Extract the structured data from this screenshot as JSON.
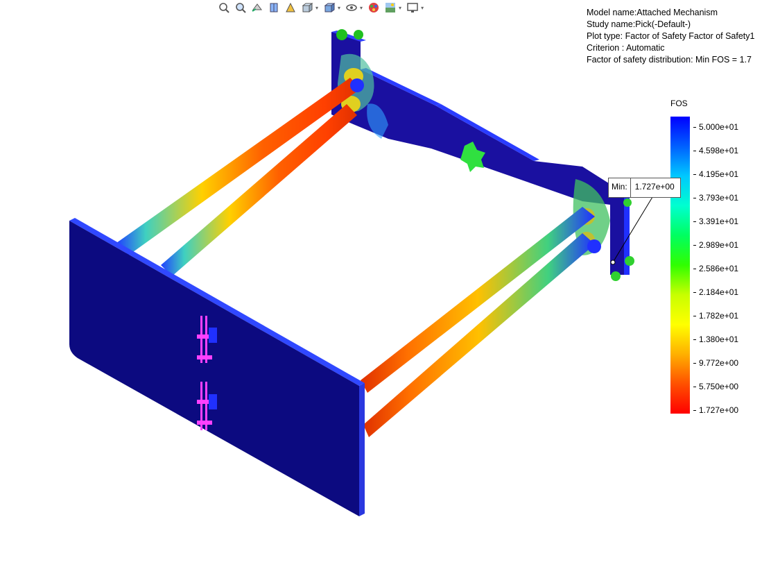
{
  "toolbar": {
    "items": [
      {
        "icon": "zoom-to-fit-icon",
        "caret": false
      },
      {
        "icon": "zoom-to-area-icon",
        "caret": false
      },
      {
        "icon": "previous-view-icon",
        "caret": false
      },
      {
        "icon": "section-view-icon",
        "caret": false
      },
      {
        "icon": "dynamic-annotation-icon",
        "caret": false
      },
      {
        "icon": "view-orientation-icon",
        "caret": true
      },
      {
        "icon": "display-style-icon",
        "caret": true
      },
      {
        "icon": "hide-show-items-icon",
        "caret": true
      },
      {
        "icon": "edit-appearance-icon",
        "caret": false
      },
      {
        "icon": "apply-scene-icon",
        "caret": true
      },
      {
        "icon": "view-settings-icon",
        "caret": true
      }
    ]
  },
  "info": {
    "model": "Model name:Attached Mechanism",
    "study": "Study name:Pick(-Default-)",
    "plot_type": "Plot type: Factor of Safety Factor of Safety1",
    "criterion": "Criterion : Automatic",
    "distribution": "Factor of safety distribution: Min FOS =  1.7"
  },
  "legend": {
    "title": "FOS",
    "ticks": [
      "5.000e+01",
      "4.598e+01",
      "4.195e+01",
      "3.793e+01",
      "3.391e+01",
      "2.989e+01",
      "2.586e+01",
      "2.184e+01",
      "1.782e+01",
      "1.380e+01",
      "9.772e+00",
      "5.750e+00",
      "1.727e+00"
    ],
    "colors": [
      "#0000ff",
      "#0060ff",
      "#00c8ff",
      "#00ffd0",
      "#00ff60",
      "#30ff00",
      "#c8ff00",
      "#ffff00",
      "#ffb000",
      "#ff5000",
      "#ff0000"
    ]
  },
  "min_probe": {
    "label": "Min:",
    "value": "1.727e+00"
  }
}
